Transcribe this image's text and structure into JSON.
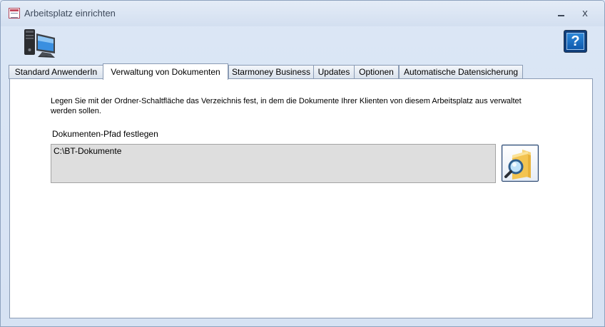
{
  "window": {
    "title": "Arbeitsplatz einrichten",
    "controls": {
      "minimize": "_",
      "close": "x"
    }
  },
  "help": {
    "label": "?"
  },
  "tabs": [
    {
      "label": "Standard AnwenderIn",
      "active": false
    },
    {
      "label": "Verwaltung von Dokumenten",
      "active": true
    },
    {
      "label": "Starmoney Business",
      "active": false
    },
    {
      "label": "Updates",
      "active": false
    },
    {
      "label": "Optionen",
      "active": false
    },
    {
      "label": "Automatische Datensicherung",
      "active": false
    }
  ],
  "content": {
    "description": "Legen Sie mit der Ordner-Schaltfläche das Verzeichnis fest, in dem die Dokumente Ihrer Klienten von diesem Arbeitsplatz aus verwaltet werden sollen.",
    "path_label": "Dokumenten-Pfad festlegen",
    "path_value": "C:\\BT-Dokumente"
  },
  "icons": {
    "app": "form-window-icon",
    "computer": "computer-icon",
    "folder_search": "folder-search-icon",
    "help": "help-icon"
  },
  "colors": {
    "window_bg": "#dfe8f6",
    "panel_bg": "#ffffff",
    "path_field_bg": "#dedede",
    "help_button": "#1364b8"
  }
}
